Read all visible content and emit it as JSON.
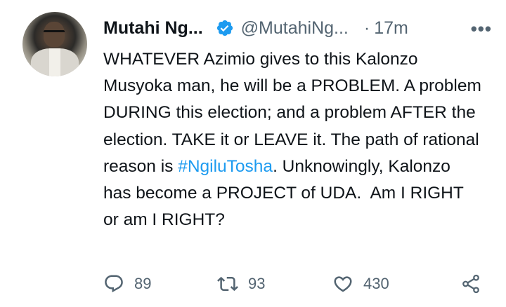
{
  "tweet": {
    "author_name": "Mutahi Ng...",
    "handle": "@MutahiNg...",
    "separator": "·",
    "time": "17m",
    "more": "•••",
    "text_before": "WHATEVER Azimio gives to this Kalonzo Musyoka man, he will be a PROBLEM. A problem DURING this election; and a problem AFTER the election. TAKE it or LEAVE it. The path of rational reason is ",
    "hashtag": "#NgiluTosha",
    "text_after": ". Unknowingly, Kalonzo has become a PROJECT of UDA.  Am I RIGHT or am I RIGHT?"
  },
  "actions": {
    "replies": "89",
    "retweets": "93",
    "likes": "430"
  },
  "icons": {
    "verified": "verified-badge-icon",
    "reply": "reply-icon",
    "retweet": "retweet-icon",
    "like": "heart-icon",
    "share": "share-icon"
  },
  "colors": {
    "accent": "#1d9bf0",
    "muted": "#536471",
    "text": "#0f1419"
  }
}
